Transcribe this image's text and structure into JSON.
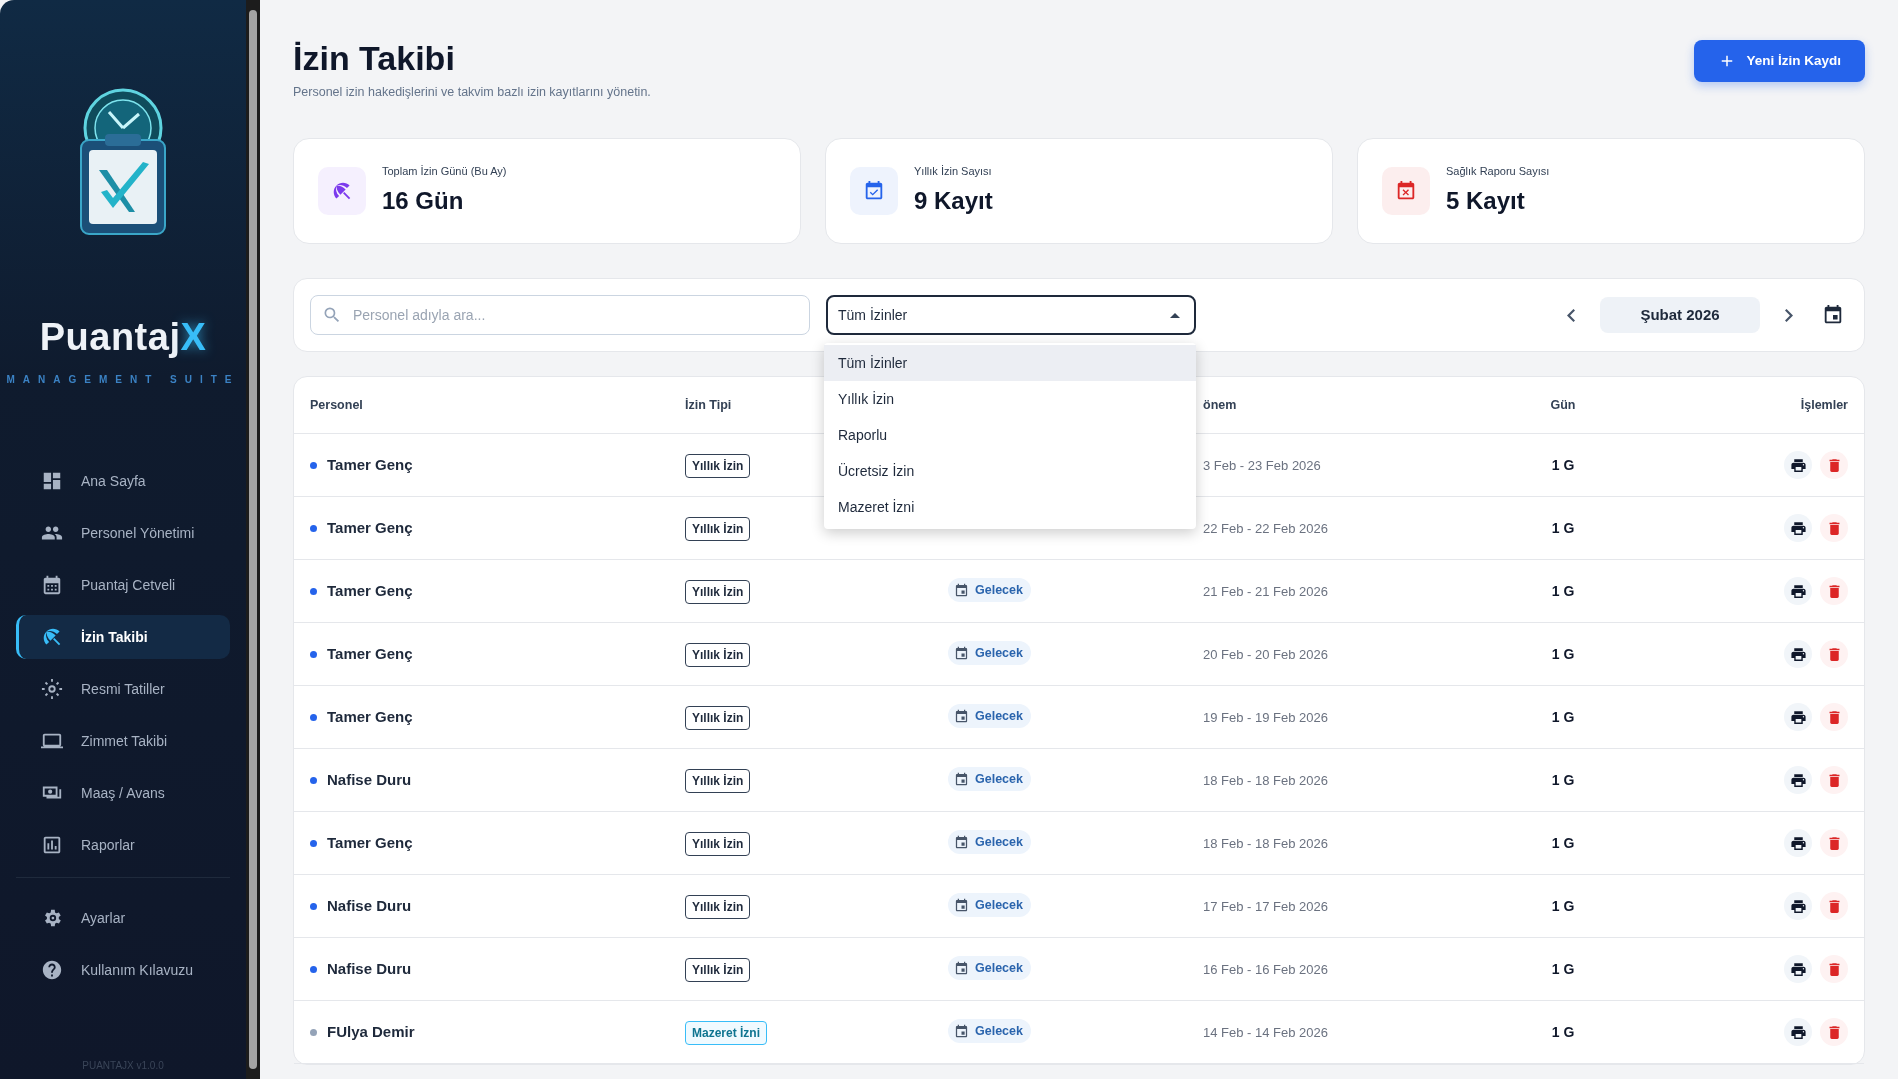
{
  "sidebar": {
    "brand": {
      "name": "Puantaj",
      "accent": "X"
    },
    "tagline": "MANAGEMENT SUITE",
    "nav": [
      {
        "label": "Ana Sayfa",
        "selected": false
      },
      {
        "label": "Personel Yönetimi",
        "selected": false
      },
      {
        "label": "Puantaj Cetveli",
        "selected": false
      },
      {
        "label": "İzin Takibi",
        "selected": true
      },
      {
        "label": "Resmi Tatiller",
        "selected": false
      },
      {
        "label": "Zimmet Takibi",
        "selected": false
      },
      {
        "label": "Maaş / Avans",
        "selected": false
      },
      {
        "label": "Raporlar",
        "selected": false
      }
    ],
    "footer_nav": [
      {
        "label": "Ayarlar",
        "selected": false
      },
      {
        "label": "Kullanım Kılavuzu",
        "selected": false
      }
    ],
    "version": "PUANTAJX v1.0.0"
  },
  "header": {
    "title": "İzin Takibi",
    "subtitle": "Personel izin hakedişlerini ve takvim bazlı izin kayıtlarını yönetin.",
    "new_button": "Yeni İzin Kaydı"
  },
  "stats": [
    {
      "label": "Toplam İzin Günü (Bu Ay)",
      "value": "16 Gün",
      "color": "#7c3aed"
    },
    {
      "label": "Yıllık İzin Sayısı",
      "value": "9 Kayıt",
      "color": "#2563eb"
    },
    {
      "label": "Sağlık Raporu Sayısı",
      "value": "5 Kayıt",
      "color": "#dc2626"
    }
  ],
  "filters": {
    "search": {
      "placeholder": "Personel adıyla ara..."
    },
    "type_select": {
      "value": "Tüm İzinler",
      "expanded": true,
      "options": [
        {
          "label": "Tüm İzinler",
          "selected": true
        },
        {
          "label": "Yıllık İzin",
          "selected": false
        },
        {
          "label": "Raporlu",
          "selected": false
        },
        {
          "label": "Ücretsiz İzin",
          "selected": false
        },
        {
          "label": "Mazeret İzni",
          "selected": false
        }
      ]
    },
    "month": "Şubat 2026"
  },
  "table": {
    "columns": {
      "personel": "Personel",
      "izin_tipi": "İzin Tipi",
      "column_4": "önem",
      "gun": "Gün",
      "islemler": "İşlemler"
    },
    "rows": [
      {
        "name": "Tamer Genç",
        "color": "#2563eb",
        "type": "Yıllık İzin",
        "kind": "annual",
        "period": "3 Feb - 23 Feb 2026",
        "days": "1 G"
      },
      {
        "name": "Tamer Genç",
        "color": "#2563eb",
        "type": "Yıllık İzin",
        "kind": "annual",
        "period": "22 Feb - 22 Feb 2026",
        "days": "1 G"
      },
      {
        "name": "Tamer Genç",
        "color": "#2563eb",
        "type": "Yıllık İzin",
        "kind": "annual",
        "status": "Gelecek",
        "period": "21 Feb - 21 Feb 2026",
        "days": "1 G"
      },
      {
        "name": "Tamer Genç",
        "color": "#2563eb",
        "type": "Yıllık İzin",
        "kind": "annual",
        "status": "Gelecek",
        "period": "20 Feb - 20 Feb 2026",
        "days": "1 G"
      },
      {
        "name": "Tamer Genç",
        "color": "#2563eb",
        "type": "Yıllık İzin",
        "kind": "annual",
        "status": "Gelecek",
        "period": "19 Feb - 19 Feb 2026",
        "days": "1 G"
      },
      {
        "name": "Nafise Duru",
        "color": "#2563eb",
        "type": "Yıllık İzin",
        "kind": "annual",
        "status": "Gelecek",
        "period": "18 Feb - 18 Feb 2026",
        "days": "1 G"
      },
      {
        "name": "Tamer Genç",
        "color": "#2563eb",
        "type": "Yıllık İzin",
        "kind": "annual",
        "status": "Gelecek",
        "period": "18 Feb - 18 Feb 2026",
        "days": "1 G"
      },
      {
        "name": "Nafise Duru",
        "color": "#2563eb",
        "type": "Yıllık İzin",
        "kind": "annual",
        "status": "Gelecek",
        "period": "17 Feb - 17 Feb 2026",
        "days": "1 G"
      },
      {
        "name": "Nafise Duru",
        "color": "#2563eb",
        "type": "Yıllık İzin",
        "kind": "annual",
        "status": "Gelecek",
        "period": "16 Feb - 16 Feb 2026",
        "days": "1 G"
      },
      {
        "name": "FUlya Demir",
        "color": "#94a3b8",
        "type": "Mazeret İzni",
        "kind": "excuse",
        "status": "Gelecek",
        "period": "14 Feb - 14 Feb 2026",
        "days": "1 G"
      }
    ]
  }
}
